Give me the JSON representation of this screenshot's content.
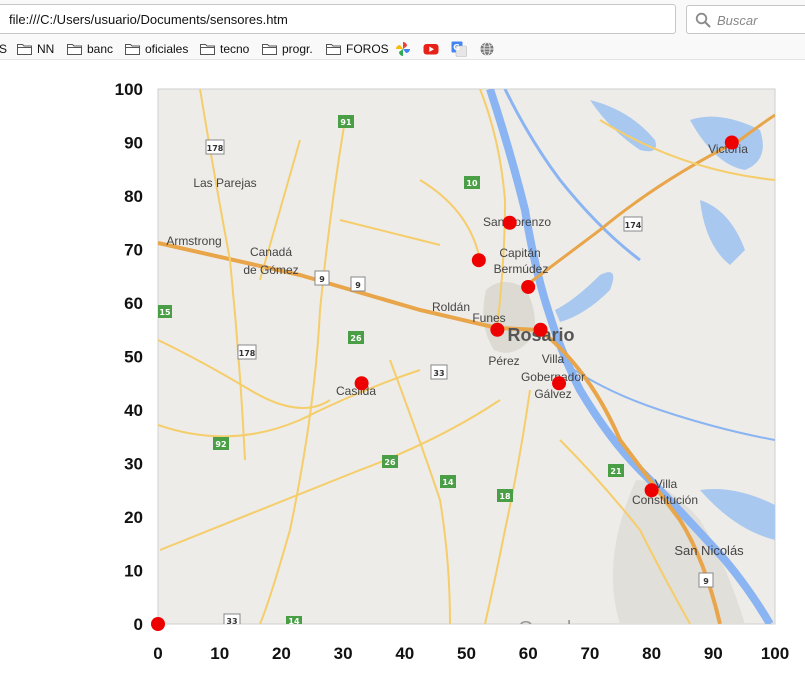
{
  "browser": {
    "url": "file:///C:/Users/usuario/Documents/sensores.htm",
    "search_placeholder": "Buscar",
    "bookmarks": [
      {
        "label": "S"
      },
      {
        "label": "NN"
      },
      {
        "label": "banc"
      },
      {
        "label": "oficiales"
      },
      {
        "label": "tecno"
      },
      {
        "label": "progr."
      },
      {
        "label": "FOROS"
      }
    ],
    "bookmark_icons": [
      "pinwheel-icon",
      "youtube-icon",
      "translate-icon",
      "globe-icon"
    ]
  },
  "map": {
    "places": [
      {
        "name": "Las Parejas"
      },
      {
        "name": "Armstrong"
      },
      {
        "name": "Canadá"
      },
      {
        "name": "de Gómez"
      },
      {
        "name": "San Lorenzo"
      },
      {
        "name": "Capitán"
      },
      {
        "name": "Bermúdez"
      },
      {
        "name": "Roldán"
      },
      {
        "name": "Funes"
      },
      {
        "name": "Rosario"
      },
      {
        "name": "Pérez"
      },
      {
        "name": "Villa"
      },
      {
        "name": "Gobernador"
      },
      {
        "name": "Gálvez"
      },
      {
        "name": "Casilda"
      },
      {
        "name": "Victoria"
      },
      {
        "name": "Villa"
      },
      {
        "name": "Constitución"
      },
      {
        "name": "San Nicolás"
      }
    ],
    "route_shields": [
      "91",
      "178",
      "10",
      "174",
      "9",
      "9",
      "15",
      "26",
      "178",
      "33",
      "92",
      "26",
      "14",
      "18",
      "21",
      "9",
      "33",
      "14"
    ],
    "watermark": "Google"
  },
  "chart_data": {
    "type": "scatter",
    "title": "",
    "xlabel": "",
    "ylabel": "",
    "xlim": [
      0,
      100
    ],
    "ylim": [
      0,
      100
    ],
    "xticks": [
      0,
      10,
      20,
      30,
      40,
      50,
      60,
      70,
      80,
      90,
      100
    ],
    "yticks": [
      0,
      10,
      20,
      30,
      40,
      50,
      60,
      70,
      80,
      90,
      100
    ],
    "grid": false,
    "marker_color": "#ee0000",
    "series": [
      {
        "points": [
          {
            "x": 0,
            "y": 0
          },
          {
            "x": 93,
            "y": 90
          },
          {
            "x": 57,
            "y": 75
          },
          {
            "x": 52,
            "y": 68
          },
          {
            "x": 60,
            "y": 63
          },
          {
            "x": 55,
            "y": 55
          },
          {
            "x": 62,
            "y": 55
          },
          {
            "x": 65,
            "y": 45
          },
          {
            "x": 33,
            "y": 45
          },
          {
            "x": 80,
            "y": 25
          }
        ]
      }
    ]
  }
}
